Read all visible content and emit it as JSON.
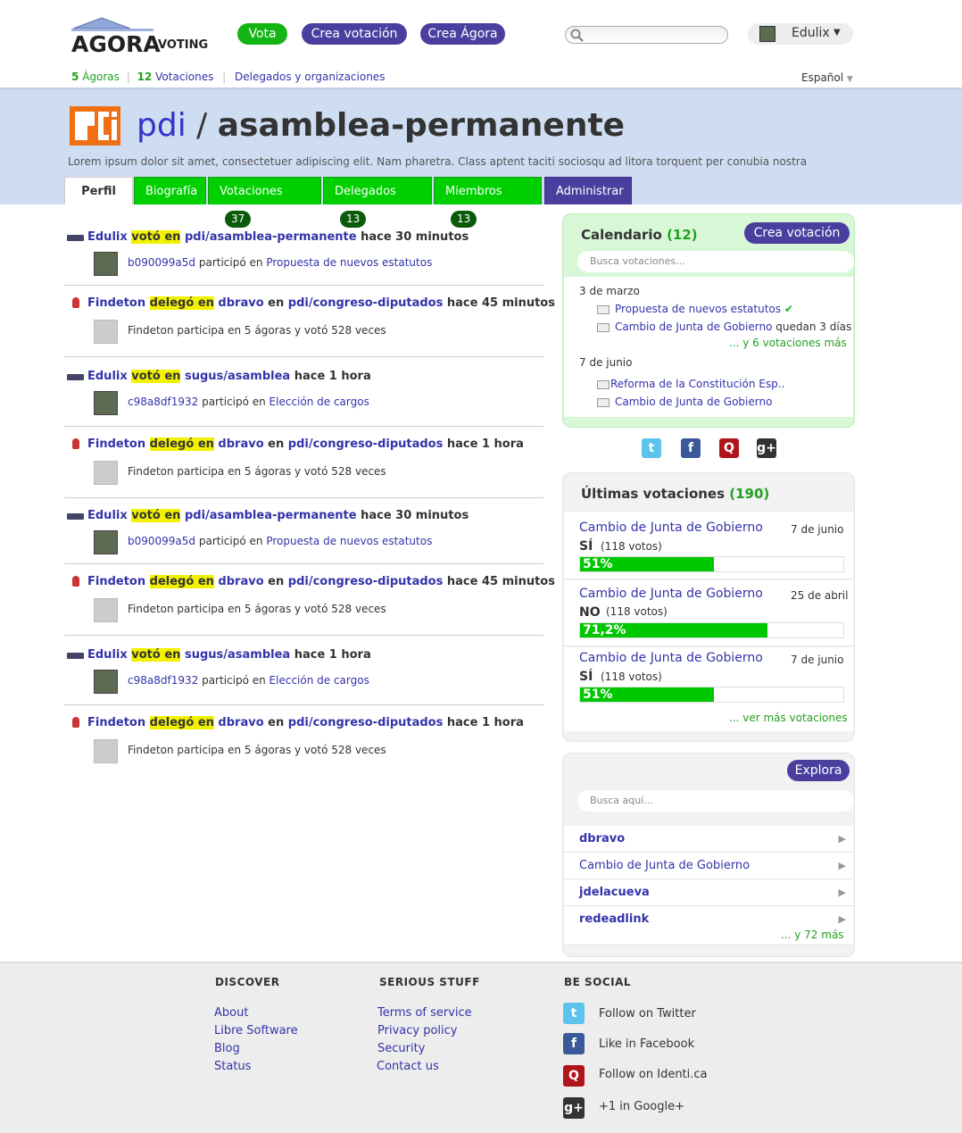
{
  "header": {
    "logo_text": "AGORA",
    "logo_sub": "VOTING",
    "nav": {
      "vote": "Vota",
      "create_vote": "Crea votación",
      "create_agora": "Crea Ágora"
    },
    "user": {
      "name": "Edulix",
      "caret": "▼"
    },
    "subnav": {
      "agoras_count": "5",
      "agoras_label": "Ágoras",
      "votes_count": "12",
      "votes_label": "Votaciones",
      "delegates_label": "Delegados y organizaciones"
    },
    "language": "Español"
  },
  "hero": {
    "org": "pdi",
    "sep": "/",
    "agora": "asamblea-permanente",
    "description": "Lorem ipsum dolor sit amet, consectetuer adipiscing elit. Nam pharetra. Class aptent taciti sociosqu ad litora torquent per conubia nostra"
  },
  "tabs": [
    {
      "label": "Perfil",
      "count": null
    },
    {
      "label": "Biografía",
      "count": null
    },
    {
      "label": "Votaciones",
      "count": "37"
    },
    {
      "label": "Delegados",
      "count": "13"
    },
    {
      "label": "Miembros",
      "count": "13"
    },
    {
      "label": "Administrar",
      "count": null
    }
  ],
  "feed": [
    {
      "user": "Edulix",
      "verb": "votó en",
      "target": "pdi/asamblea-permanente",
      "time": "hace 30 minutos",
      "sub_user": "b090099a5d",
      "sub_text": "participó en",
      "sub_link": "Propuesta de nuevos estatutos"
    },
    {
      "user": "Findeton",
      "verb": "delegó en",
      "target": "dbravo",
      "en": "en",
      "target2": "pdi/congreso-diputados",
      "time": "hace 45 minutos",
      "sub_text": "Findeton participa en 5 ágoras y votó 528 veces"
    },
    {
      "user": "Edulix",
      "verb": "votó en",
      "target": "sugus/asamblea",
      "time": "hace 1 hora",
      "sub_user": "c98a8df1932",
      "sub_text": "participó en",
      "sub_link": "Elección de cargos"
    },
    {
      "user": "Findeton",
      "verb": "delegó en",
      "target": "dbravo",
      "en": "en",
      "target2": "pdi/congreso-diputados",
      "time": "hace 1 hora",
      "sub_text": "Findeton participa en 5 ágoras y votó 528 veces"
    },
    {
      "user": "Edulix",
      "verb": "votó en",
      "target": "pdi/asamblea-permanente",
      "time": "hace 30 minutos",
      "sub_user": "b090099a5d",
      "sub_text": "participó en",
      "sub_link": "Propuesta de nuevos estatutos"
    },
    {
      "user": "Findeton",
      "verb": "delegó en",
      "target": "dbravo",
      "en": "en",
      "target2": "pdi/congreso-diputados",
      "time": "hace 45 minutos",
      "sub_text": "Findeton participa en 5 ágoras y votó 528 veces"
    },
    {
      "user": "Edulix",
      "verb": "votó en",
      "target": "sugus/asamblea",
      "time": "hace 1 hora",
      "sub_user": "c98a8df1932",
      "sub_text": "participó en",
      "sub_link": "Elección de cargos"
    },
    {
      "user": "Findeton",
      "verb": "delegó en",
      "target": "dbravo",
      "en": "en",
      "target2": "pdi/congreso-diputados",
      "time": "hace 1 hora",
      "sub_text": "Findeton participa en 5 ágoras y votó 528 veces"
    }
  ],
  "calendar": {
    "title": "Calendario",
    "count": "(12)",
    "button": "Crea votación",
    "search_placeholder": "Busca votaciones...",
    "day1": "3 de marzo",
    "d1_item1": "Propuesta de nuevos estatutos",
    "d1_check": "✔",
    "d1_item2": "Cambio de Junta de Gobierno",
    "d1_item2_note": "quedan 3 días",
    "d1_more": "... y 6 votaciones más",
    "day2": "7 de junio",
    "d2_item1": "Reforma de la Constitución Esp..",
    "d2_item2": "Cambio de Junta de Gobierno"
  },
  "social_icons": [
    "twitter-icon",
    "facebook-icon",
    "identica-icon",
    "googleplus-icon"
  ],
  "latest": {
    "title": "Últimas votaciones",
    "count": "(190)",
    "items": [
      {
        "title": "Cambio de Junta de Gobierno",
        "date": "7 de junio",
        "answer": "SÍ",
        "votes": "(118 votos)",
        "percent_label": "51%",
        "percent": 0.51
      },
      {
        "title": "Cambio de Junta de Gobierno",
        "date": "25 de abril",
        "answer": "NO",
        "votes": "(118 votos)",
        "percent_label": "71,2%",
        "percent": 0.712
      },
      {
        "title": "Cambio de Junta de Gobierno",
        "date": "7 de junio",
        "answer": "SÍ",
        "votes": "(118 votos)",
        "percent_label": "51%",
        "percent": 0.51
      }
    ],
    "more": "... ver más votaciones"
  },
  "explore": {
    "button": "Explora",
    "search_placeholder": "Busca aquí...",
    "items": [
      "dbravo",
      "Cambio de Junta de Gobierno",
      "jdelacueva",
      "redeadlink"
    ],
    "more": "... y 72 más"
  },
  "footer": {
    "discover": {
      "title": "DISCOVER",
      "links": [
        "About",
        "Libre Software",
        "Blog",
        "Status"
      ]
    },
    "serious": {
      "title": "SERIOUS STUFF",
      "links": [
        "Terms of service",
        "Privacy policy",
        "Security",
        "Contact us"
      ]
    },
    "social": {
      "title": "BE SOCIAL",
      "links": [
        "Follow on Twitter",
        "Like in Facebook",
        "Follow on Identi.ca",
        "+1 in Google+"
      ]
    }
  },
  "colors": {
    "green": "#00c800",
    "purple": "#4a3f9e",
    "hero_bg": "#cfddf2",
    "link": "#3333aa"
  }
}
